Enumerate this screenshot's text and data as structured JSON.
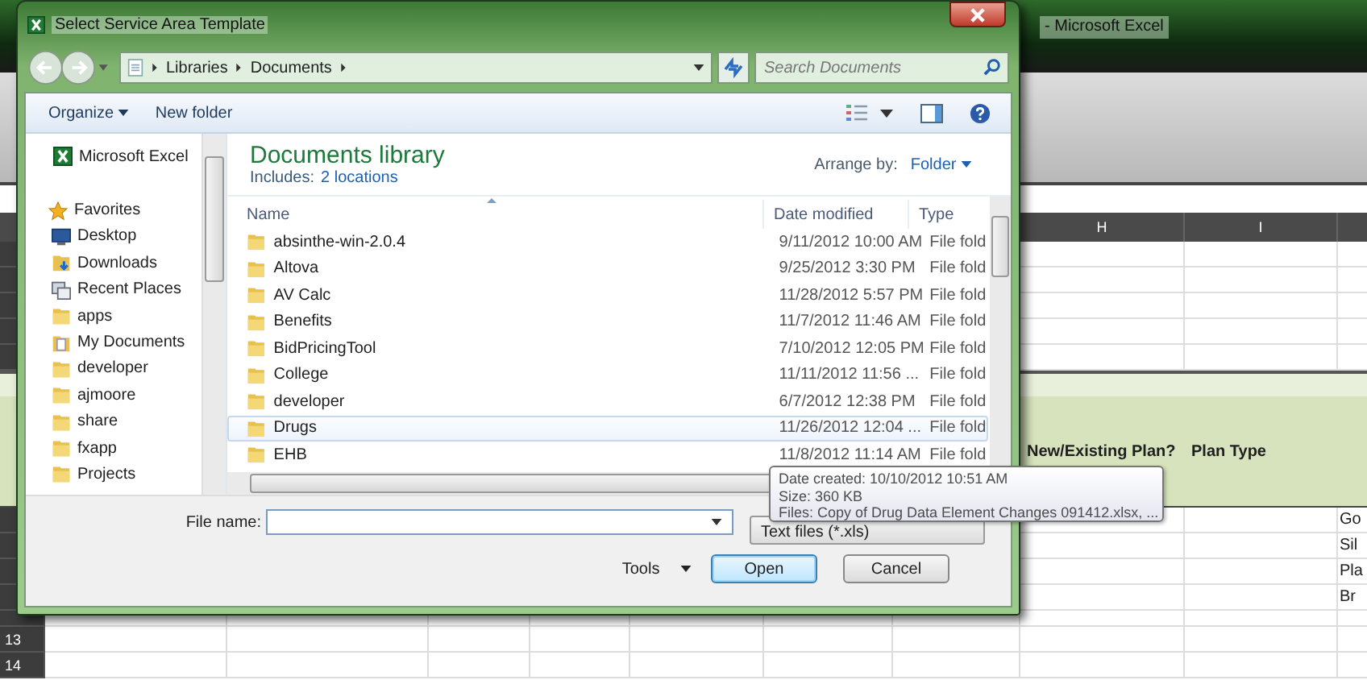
{
  "excel": {
    "title": "- Microsoft Excel",
    "column_headers": [
      "H",
      "I"
    ],
    "table_headers": [
      "New/Existing Plan?",
      "Plan Type"
    ],
    "column_3_cells": [
      "Go",
      "Sil",
      "Pla",
      "Br"
    ],
    "row_numbers": [
      "13",
      "14"
    ]
  },
  "dialog": {
    "title": "Select Service Area Template",
    "breadcrumb": [
      "Libraries",
      "Documents"
    ],
    "search": {
      "placeholder": "Search Documents"
    },
    "toolbar": {
      "organize": "Organize",
      "new_folder": "New folder"
    },
    "nav": [
      {
        "label": "Microsoft Excel",
        "kind": "excel"
      },
      {
        "label": "Favorites",
        "kind": "favorites"
      },
      {
        "label": "Desktop",
        "kind": "desktop"
      },
      {
        "label": "Downloads",
        "kind": "downloads"
      },
      {
        "label": "Recent Places",
        "kind": "recent"
      },
      {
        "label": "apps",
        "kind": "folder"
      },
      {
        "label": "My Documents",
        "kind": "mydocs"
      },
      {
        "label": "developer",
        "kind": "folder"
      },
      {
        "label": "ajmoore",
        "kind": "folder"
      },
      {
        "label": "share",
        "kind": "folder"
      },
      {
        "label": "fxapp",
        "kind": "folder"
      },
      {
        "label": "Projects",
        "kind": "folder"
      }
    ],
    "library": {
      "title": "Documents library",
      "includes": "Includes:",
      "locations": "2 locations",
      "arrange_label": "Arrange by:",
      "arrange_value": "Folder"
    },
    "columns": [
      "Name",
      "Date modified",
      "Type"
    ],
    "rows": [
      {
        "name": "absinthe-win-2.0.4",
        "date": "9/11/2012 10:00 AM",
        "type": "File fold",
        "selected": false
      },
      {
        "name": "Altova",
        "date": "9/25/2012 3:30 PM",
        "type": "File fold",
        "selected": false
      },
      {
        "name": "AV Calc",
        "date": "11/28/2012 5:57 PM",
        "type": "File fold",
        "selected": false
      },
      {
        "name": "Benefits",
        "date": "11/7/2012 11:46 AM",
        "type": "File fold",
        "selected": false
      },
      {
        "name": "BidPricingTool",
        "date": "7/10/2012 12:05 PM",
        "type": "File fold",
        "selected": false
      },
      {
        "name": "College",
        "date": "11/11/2012 11:56 ...",
        "type": "File fold",
        "selected": false
      },
      {
        "name": "developer",
        "date": "6/7/2012 12:38 PM",
        "type": "File fold",
        "selected": false
      },
      {
        "name": "Drugs",
        "date": "11/26/2012 12:04 ...",
        "type": "File fold",
        "selected": true
      },
      {
        "name": "EHB",
        "date": "11/8/2012 11:14 AM",
        "type": "File fold",
        "selected": false
      }
    ],
    "file_name": {
      "label": "File name:"
    },
    "file_type": "Text files (*.xls)",
    "tools": "Tools",
    "open": "Open",
    "cancel": "Cancel"
  },
  "tooltip": [
    "Date created: 10/10/2012 10:51 AM",
    "Size: 360 KB",
    "Files: Copy of Drug Data Element Changes 091412.xlsx, ..."
  ]
}
